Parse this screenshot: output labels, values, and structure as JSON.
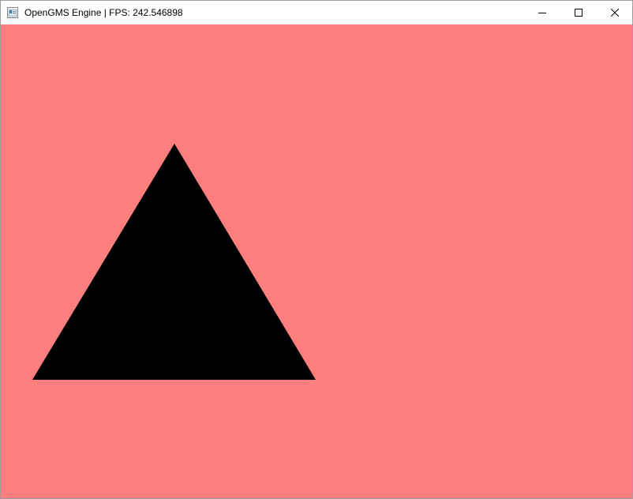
{
  "window": {
    "title": "OpenGMS Engine | FPS: 242.546898",
    "icon": "application-window-icon",
    "buttons": {
      "minimize": "minimize-icon",
      "maximize": "maximize-icon",
      "close": "close-icon"
    }
  },
  "scene": {
    "clear_color": "#ff7f7f",
    "shape": "triangle",
    "shape_color": "#000000"
  }
}
